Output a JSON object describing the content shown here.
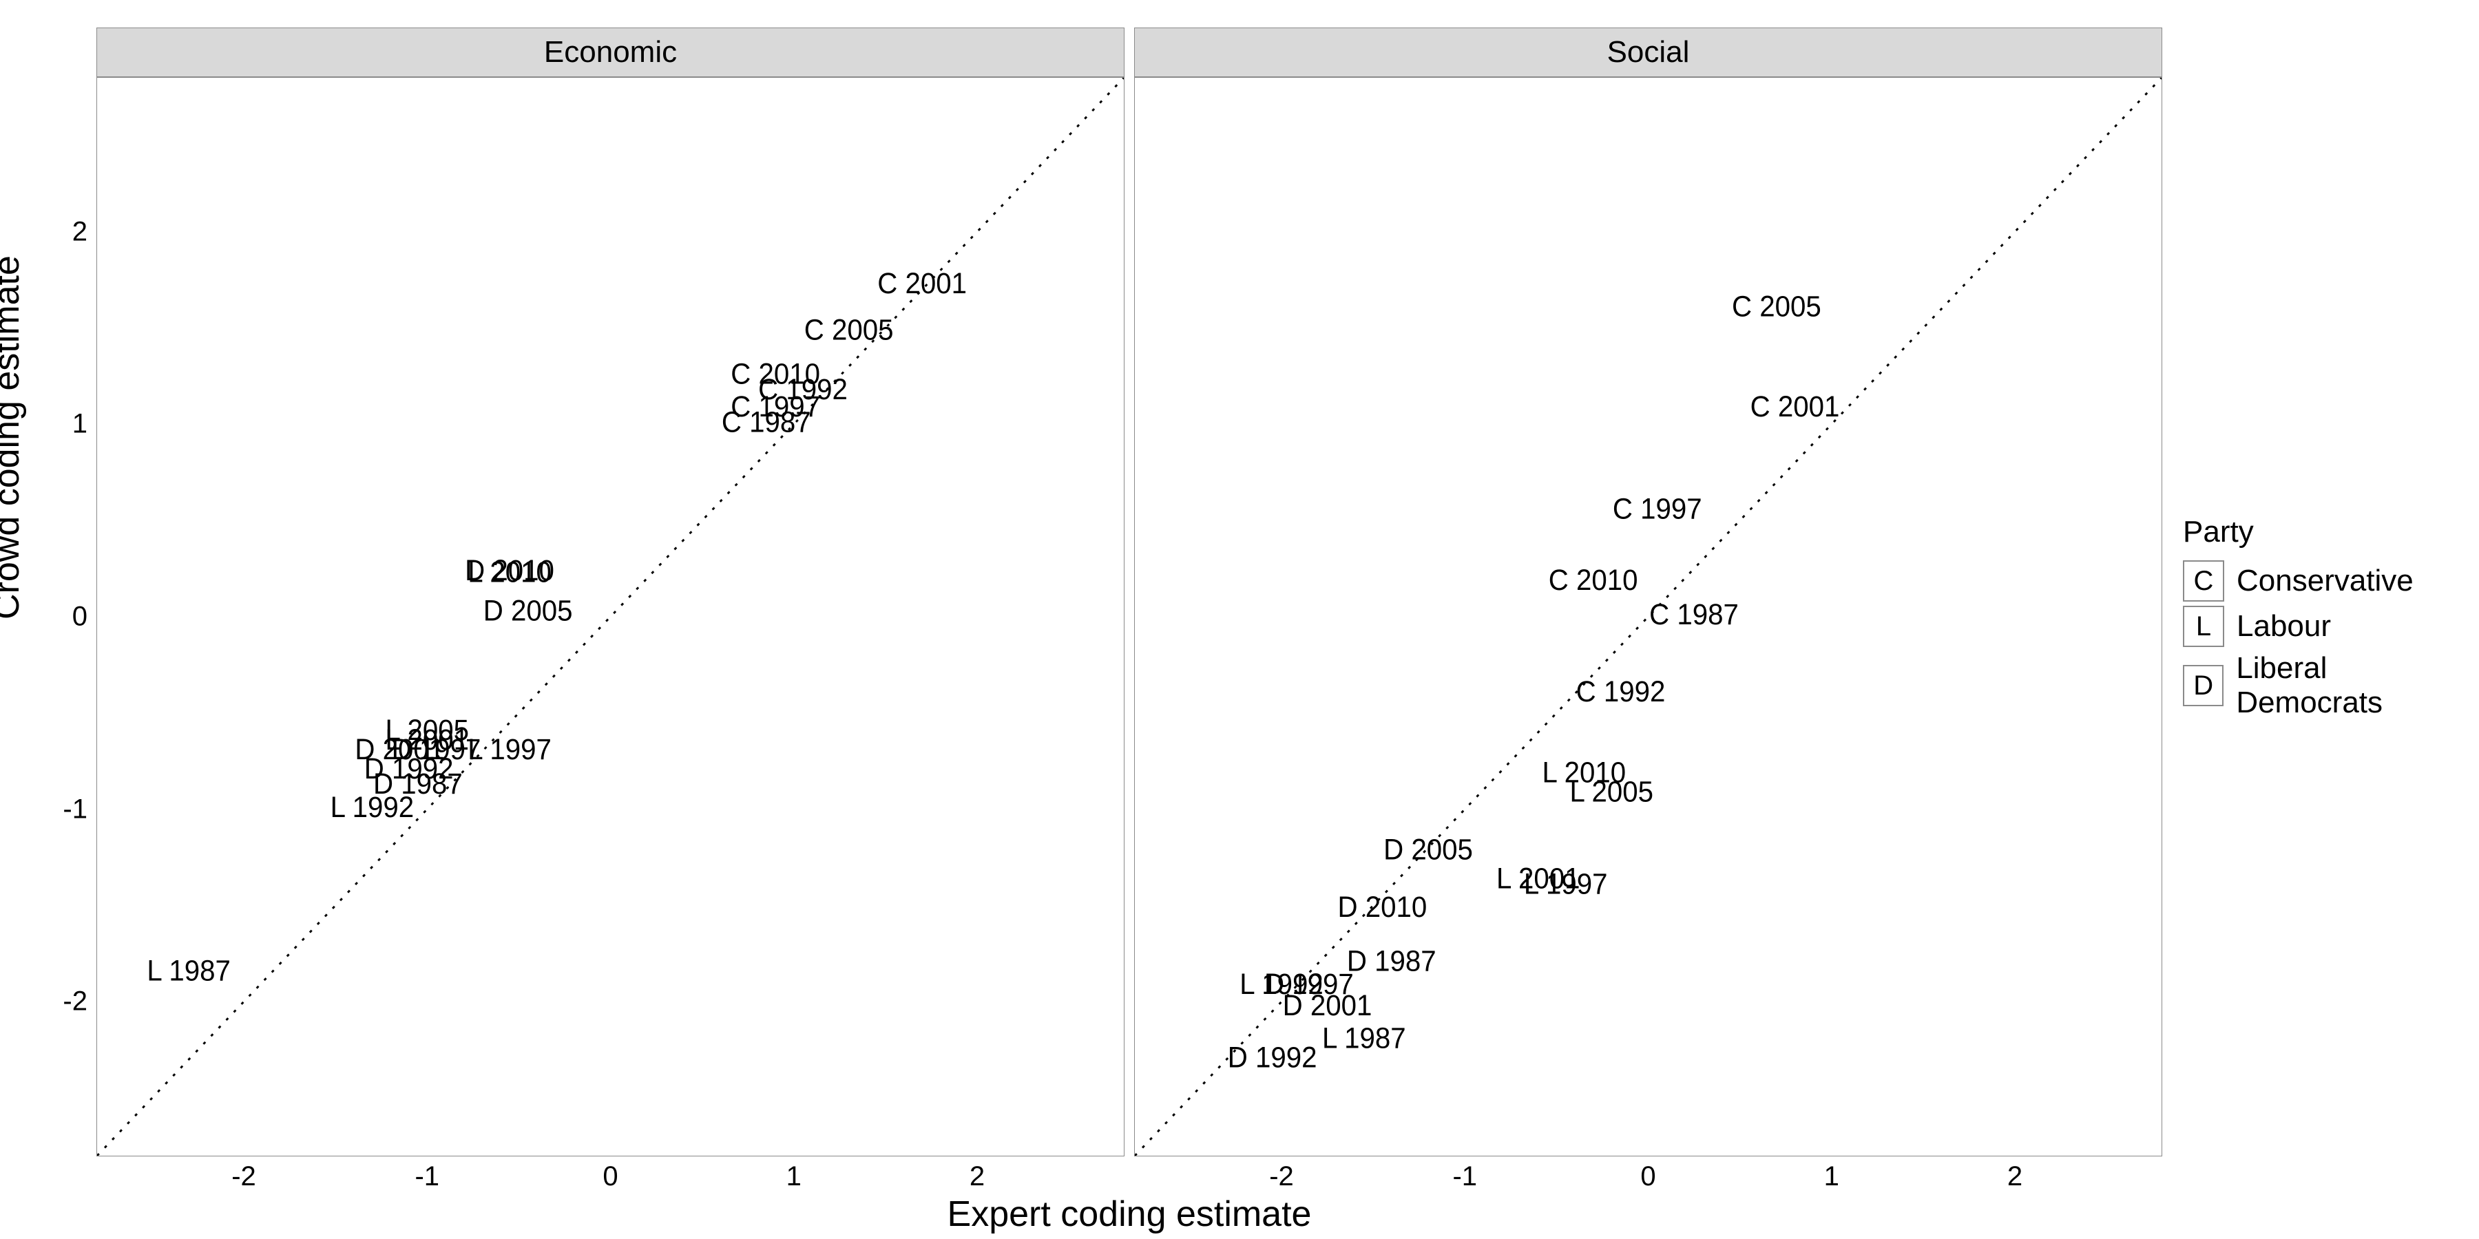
{
  "chart_data": [
    {
      "type": "scatter",
      "facet": "Economic",
      "xlabel": "Expert coding estimate",
      "ylabel": "Crowd coding estimate",
      "xlim": [
        -2.8,
        2.8
      ],
      "ylim": [
        -2.8,
        2.8
      ],
      "ticks": [
        -2,
        -1,
        0,
        1,
        2
      ],
      "refline": {
        "slope": 1,
        "intercept": 0,
        "style": "dotted"
      },
      "series": [
        {
          "name": "Conservative",
          "key": "C"
        },
        {
          "name": "Labour",
          "key": "L"
        },
        {
          "name": "Liberal Democrats",
          "key": "D"
        }
      ],
      "points": [
        {
          "label": "L 1987",
          "x": -2.3,
          "y": -1.85
        },
        {
          "label": "L 1992",
          "x": -1.3,
          "y": -1.0
        },
        {
          "label": "D 1987",
          "x": -1.05,
          "y": -0.88
        },
        {
          "label": "D 1992",
          "x": -1.1,
          "y": -0.8
        },
        {
          "label": "D 2001",
          "x": -1.15,
          "y": -0.7
        },
        {
          "label": "L 1997",
          "x": -0.55,
          "y": -0.7
        },
        {
          "label": "D 1997",
          "x": -0.95,
          "y": -0.7
        },
        {
          "label": "L 2001",
          "x": -1.0,
          "y": -0.65
        },
        {
          "label": "L 2005",
          "x": -1.0,
          "y": -0.6
        },
        {
          "label": "D 2005",
          "x": -0.45,
          "y": 0.02
        },
        {
          "label": "L 2010",
          "x": -0.55,
          "y": 0.22
        },
        {
          "label": "D 2010",
          "x": -0.55,
          "y": 0.23
        },
        {
          "label": "C 1987",
          "x": 0.85,
          "y": 1.0
        },
        {
          "label": "C 1997",
          "x": 0.9,
          "y": 1.08
        },
        {
          "label": "C 1992",
          "x": 1.05,
          "y": 1.17
        },
        {
          "label": "C 2010",
          "x": 0.9,
          "y": 1.25
        },
        {
          "label": "C 2005",
          "x": 1.3,
          "y": 1.48
        },
        {
          "label": "C 2001",
          "x": 1.7,
          "y": 1.72
        }
      ]
    },
    {
      "type": "scatter",
      "facet": "Social",
      "xlabel": "Expert coding estimate",
      "ylabel": "Crowd coding estimate",
      "xlim": [
        -2.8,
        2.8
      ],
      "ylim": [
        -2.8,
        2.8
      ],
      "ticks": [
        -2,
        -1,
        0,
        1,
        2
      ],
      "refline": {
        "slope": 1,
        "intercept": 0,
        "style": "dotted"
      },
      "series": [
        {
          "name": "Conservative",
          "key": "C"
        },
        {
          "name": "Labour",
          "key": "L"
        },
        {
          "name": "Liberal Democrats",
          "key": "D"
        }
      ],
      "points": [
        {
          "label": "D 1992",
          "x": -2.05,
          "y": -2.3
        },
        {
          "label": "L 1987",
          "x": -1.55,
          "y": -2.2
        },
        {
          "label": "D 2001",
          "x": -1.75,
          "y": -2.03
        },
        {
          "label": "D 1997",
          "x": -1.85,
          "y": -1.92
        },
        {
          "label": "L 1992",
          "x": -2.0,
          "y": -1.92
        },
        {
          "label": "D 1987",
          "x": -1.4,
          "y": -1.8
        },
        {
          "label": "D 2010",
          "x": -1.45,
          "y": -1.52
        },
        {
          "label": "L 2001",
          "x": -0.6,
          "y": -1.37
        },
        {
          "label": "L 1997",
          "x": -0.45,
          "y": -1.4
        },
        {
          "label": "D 2005",
          "x": -1.2,
          "y": -1.22
        },
        {
          "label": "L 2005",
          "x": -0.2,
          "y": -0.92
        },
        {
          "label": "L 2010",
          "x": -0.35,
          "y": -0.82
        },
        {
          "label": "C 1992",
          "x": -0.15,
          "y": -0.4
        },
        {
          "label": "C 1987",
          "x": 0.25,
          "y": 0.0
        },
        {
          "label": "C 2010",
          "x": -0.3,
          "y": 0.18
        },
        {
          "label": "C 1997",
          "x": 0.05,
          "y": 0.55
        },
        {
          "label": "C 2001",
          "x": 0.8,
          "y": 1.08
        },
        {
          "label": "C 2005",
          "x": 0.7,
          "y": 1.6
        }
      ]
    }
  ],
  "facets": {
    "0": "Economic",
    "1": "Social"
  },
  "axis": {
    "xlabel": "Expert coding estimate",
    "ylabel": "Crowd coding estimate"
  },
  "legend": {
    "title": "Party",
    "items": [
      {
        "key": "C",
        "label": "Conservative"
      },
      {
        "key": "L",
        "label": "Labour"
      },
      {
        "key": "D",
        "label": "Liberal Democrats"
      }
    ]
  }
}
